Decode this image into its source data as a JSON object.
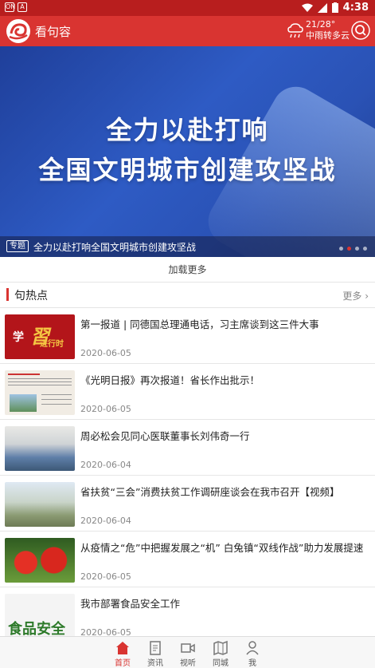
{
  "status_bar": {
    "time": "4:38"
  },
  "app": {
    "title": "看句容"
  },
  "weather": {
    "temp": "21/28°",
    "desc": "中雨转多云"
  },
  "banner": {
    "headline_line1": "全力以赴打响",
    "headline_line2": "全国文明城市创建攻坚战",
    "tag": "专题",
    "caption": "全力以赴打响全国文明城市创建攻坚战"
  },
  "load_more": "加载更多",
  "section": {
    "title": "句热点",
    "more": "更多"
  },
  "news": [
    {
      "title": "第一报道 | 同德国总理通电话，习主席谈到这三件大事",
      "date": "2020-06-05",
      "thumb": "study-progress"
    },
    {
      "title": "《光明日报》再次报道！省长作出批示！",
      "date": "2020-06-05",
      "thumb": "newspaper"
    },
    {
      "title": "周必松会见同心医联董事长刘伟奇一行",
      "date": "2020-06-04",
      "thumb": "meeting-room"
    },
    {
      "title": "省扶贫“三会”消费扶贫工作调研座谈会在我市召开【视频】",
      "date": "2020-06-04",
      "thumb": "field-visit"
    },
    {
      "title": "从疫情之“危”中把握发展之“机” 白兔镇“双线作战”助力发展提速",
      "date": "2020-06-05",
      "thumb": "strawberries"
    },
    {
      "title": "我市部署食品安全工作",
      "date": "2020-06-05",
      "thumb": "food-safety"
    }
  ],
  "thumb_text": {
    "t1_main": "学",
    "t1_sub": "进行时",
    "t6_main": "食品安全"
  },
  "bottom_nav": [
    {
      "label": "首页",
      "icon": "home-icon"
    },
    {
      "label": "资讯",
      "icon": "news-icon"
    },
    {
      "label": "视听",
      "icon": "video-icon"
    },
    {
      "label": "同城",
      "icon": "map-icon"
    },
    {
      "label": "我",
      "icon": "user-icon"
    }
  ],
  "colors": {
    "brand": "#d93431",
    "status_bar": "#b81e1e"
  }
}
